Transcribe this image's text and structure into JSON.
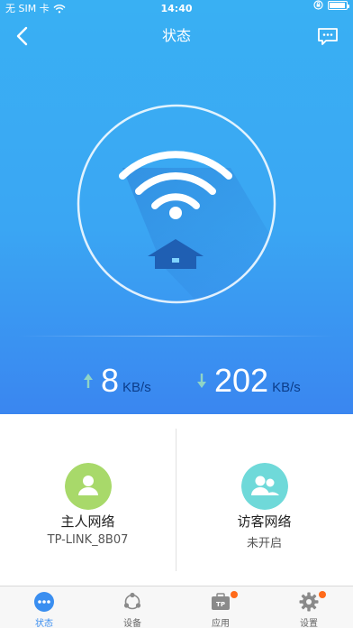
{
  "status_bar": {
    "carrier": "无 SIM 卡",
    "time": "14:40"
  },
  "nav": {
    "title": "状态"
  },
  "speed": {
    "upload_value": "8",
    "upload_unit": "KB/s",
    "download_value": "202",
    "download_unit": "KB/s"
  },
  "cards": {
    "host": {
      "title": "主人网络",
      "subtitle": "TP-LINK_8B07"
    },
    "guest": {
      "title": "访客网络",
      "subtitle": "未开启"
    }
  },
  "tabs": [
    {
      "label": "状态",
      "icon": "status-icon",
      "active": true
    },
    {
      "label": "设备",
      "icon": "devices-icon",
      "active": false
    },
    {
      "label": "应用",
      "icon": "apps-icon",
      "active": false,
      "badge": true
    },
    {
      "label": "设置",
      "icon": "settings-gear-icon",
      "active": false,
      "badge": true
    }
  ],
  "colors": {
    "hero_top": "#39b0f3",
    "hero_bottom": "#3a86f0",
    "accent": "#3a8ef0",
    "host_avatar": "#a8d96a",
    "guest_avatar": "#6fd9d9",
    "badge": "#ff6a1a"
  }
}
